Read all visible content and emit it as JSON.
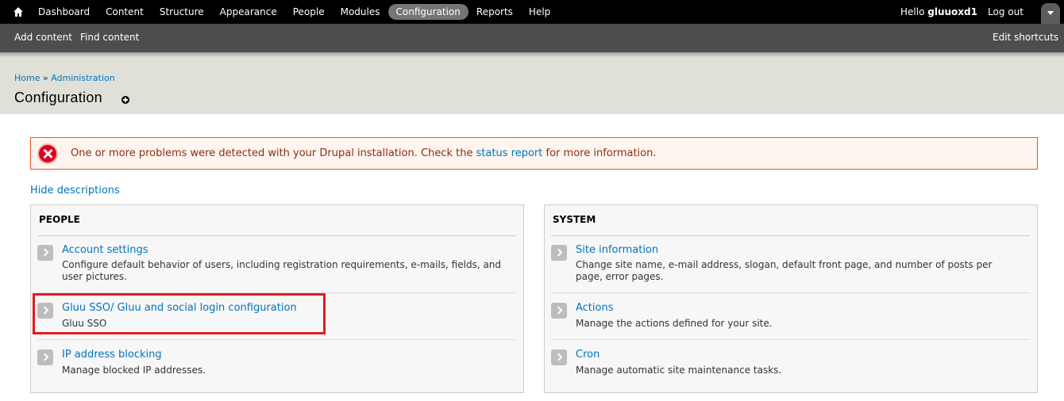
{
  "toolbar": {
    "menu": [
      "Dashboard",
      "Content",
      "Structure",
      "Appearance",
      "People",
      "Modules",
      "Configuration",
      "Reports",
      "Help"
    ],
    "active": "Configuration",
    "hello_prefix": "Hello ",
    "username": "gluuoxd1",
    "logout": "Log out"
  },
  "shortcuts": {
    "add_content": "Add content",
    "find_content": "Find content",
    "edit_shortcuts": "Edit shortcuts"
  },
  "breadcrumb": {
    "home": "Home",
    "sep": " » ",
    "administration": "Administration"
  },
  "page_title": "Configuration",
  "message": {
    "text_before": "One or more problems were detected with your Drupal installation. Check the ",
    "link": "status report",
    "text_after": " for more information."
  },
  "hide_descriptions": "Hide descriptions",
  "panels": {
    "people": {
      "title": "PEOPLE",
      "items": [
        {
          "title": "Account settings",
          "desc": "Configure default behavior of users, including registration requirements, e-mails, fields, and user pictures."
        },
        {
          "title": "Gluu SSO/ Gluu and social login configuration",
          "desc": "Gluu SSO"
        },
        {
          "title": "IP address blocking",
          "desc": "Manage blocked IP addresses."
        }
      ]
    },
    "system": {
      "title": "SYSTEM",
      "items": [
        {
          "title": "Site information",
          "desc": "Change site name, e-mail address, slogan, default front page, and number of posts per page, error pages."
        },
        {
          "title": "Actions",
          "desc": "Manage the actions defined for your site."
        },
        {
          "title": "Cron",
          "desc": "Manage automatic site maintenance tasks."
        }
      ]
    }
  }
}
